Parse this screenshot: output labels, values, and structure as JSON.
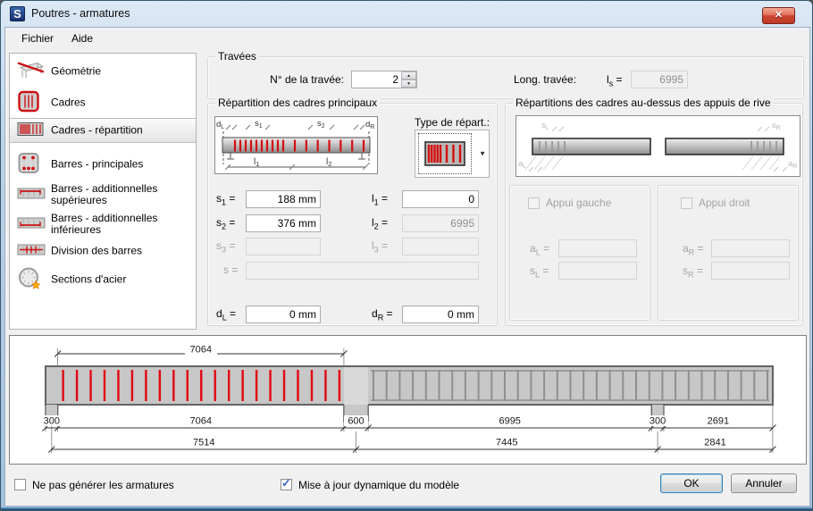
{
  "window": {
    "title": "Poutres - armatures",
    "logo_letter": "S",
    "close_glyph": "✕"
  },
  "menu": {
    "fichier": "Fichier",
    "aide": "Aide"
  },
  "sidebar": {
    "items": [
      {
        "label": "Géométrie"
      },
      {
        "label": "Cadres"
      },
      {
        "label": "Cadres - répartition",
        "selected": true
      },
      {
        "label": "Barres - principales"
      },
      {
        "label": "Barres - additionnelles supérieures"
      },
      {
        "label": "Barres - additionnelles inférieures"
      },
      {
        "label": "Division des barres"
      },
      {
        "label": "Sections d'acier"
      }
    ]
  },
  "travees": {
    "title": "Travées",
    "num_label": "N° de la travée:",
    "num_value": "2",
    "long_label": "Long. travée:",
    "long_sym": "l",
    "long_sub": "s",
    "long_eq": "=",
    "long_value": "6995"
  },
  "repartition": {
    "title": "Répartition des cadres principaux",
    "type_label": "Type de répart.:",
    "labels": {
      "s1_sym": "s",
      "s1_sub": "1",
      "s1_eq": "=",
      "s2_sym": "s",
      "s2_sub": "2",
      "s2_eq": "=",
      "s3_sym": "s",
      "s3_sub": "3",
      "s3_eq": "=",
      "s_sym": "s",
      "s_sub": "",
      "s_eq": "=",
      "l1_sym": "l",
      "l1_sub": "1",
      "l1_eq": "=",
      "l2_sym": "l",
      "l2_sub": "2",
      "l2_eq": "=",
      "l3_sym": "l",
      "l3_sub": "3",
      "l3_eq": "=",
      "dl_sym": "d",
      "dl_sub": "L",
      "dl_eq": "=",
      "dr_sym": "d",
      "dr_sub": "R",
      "dr_eq": "="
    },
    "values": {
      "s1": "188 mm",
      "s2": "376 mm",
      "s3": "",
      "s": "",
      "l1": "0",
      "l2": "6995",
      "l3": "",
      "dl": "0 mm",
      "dr": "0 mm"
    },
    "diagram": {
      "dl": "d",
      "dl_sub": "L",
      "s1": "s",
      "s1_sub": "1",
      "s2": "s",
      "s2_sub": "2",
      "dr": "d",
      "dr_sub": "R",
      "l1": "l",
      "l1_sub": "1",
      "l2": "l",
      "l2_sub": "2"
    }
  },
  "rive": {
    "title": "Répartitions des cadres au-dessus des appuis de rive",
    "diagram": {
      "sl": "s",
      "sl_sub": "L",
      "al": "a",
      "al_sub": "L",
      "sr": "s",
      "sr_sub": "R",
      "ar": "a",
      "ar_sub": "R"
    },
    "gauche": {
      "title": "Appui gauche",
      "a_sym": "a",
      "a_sub": "L",
      "a_eq": "=",
      "s_sym": "s",
      "s_sub": "L",
      "s_eq": "=",
      "a_value": "",
      "s_value": ""
    },
    "droit": {
      "title": "Appui droit",
      "a_sym": "a",
      "a_sub": "R",
      "a_eq": "=",
      "s_sym": "s",
      "s_sub": "R",
      "s_eq": "=",
      "a_value": "",
      "s_value": ""
    }
  },
  "beam_diagram": {
    "dim_top": "7064",
    "dims_row1": [
      "300",
      "7064",
      "600",
      "6995",
      "300",
      "2691"
    ],
    "dims_row2": [
      "7514",
      "7445",
      "2841"
    ]
  },
  "footer": {
    "no_generate_label": "Ne pas générer les armatures",
    "dynamic_label": "Mise à jour dynamique du modèle",
    "dynamic_check": "✓",
    "ok": "OK",
    "cancel": "Annuler"
  },
  "colors": {
    "stirrup_red": "#e00812",
    "accent_blue": "#3c7fb1",
    "titlebar_blue": "#bcd2e8"
  }
}
